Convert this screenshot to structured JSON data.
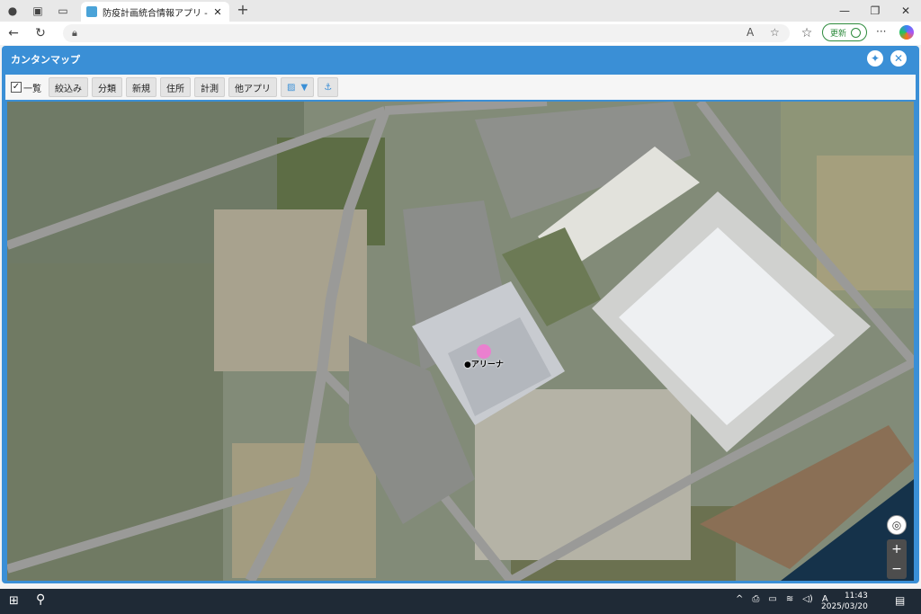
{
  "browser": {
    "tab_title": "防疫計画統合情報アプリ - レコードの",
    "tab_close": "✕",
    "new_tab": "+",
    "update_label": "更新",
    "read_aloud": "A",
    "more": "···"
  },
  "app": {
    "title": "カンタンマップ",
    "toolbar": {
      "list_label": "一覧",
      "filter": "絞込み",
      "classify": "分類",
      "new": "新規",
      "address": "住所",
      "measure": "計測",
      "other_apps": "他アプリ"
    },
    "map": {
      "marker_label": "●アリーナ",
      "zoom_in": "+",
      "zoom_out": "−"
    }
  },
  "taskbar": {
    "ime": "A",
    "time": "11:43",
    "date": "2025/03/20"
  },
  "colors": {
    "app_blue": "#3a8fd6",
    "marker_pink": "#f07ad0"
  }
}
